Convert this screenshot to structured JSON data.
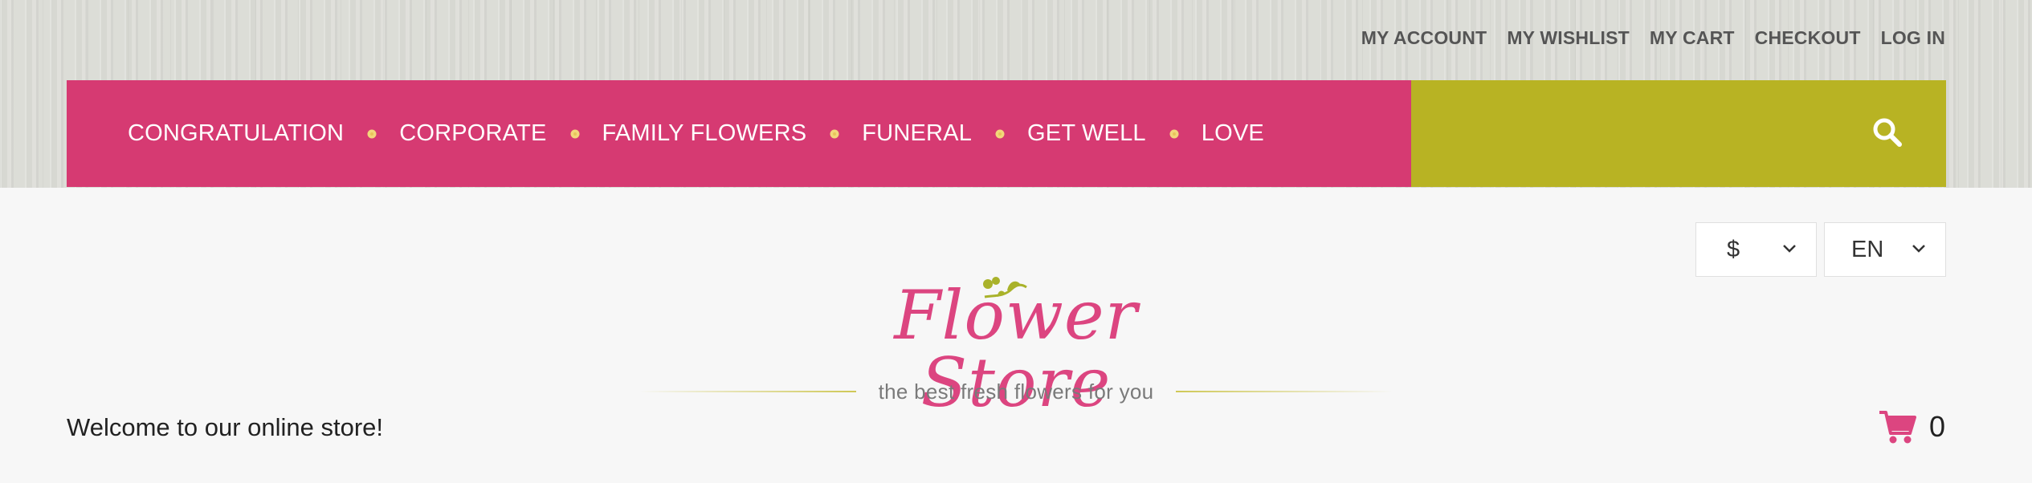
{
  "account_links": [
    "MY ACCOUNT",
    "MY WISHLIST",
    "MY CART",
    "CHECKOUT",
    "LOG IN"
  ],
  "nav": {
    "items": [
      "CONGRATULATION",
      "CORPORATE",
      "FAMILY FLOWERS",
      "FUNERAL",
      "GET WELL",
      "LOVE"
    ],
    "separator_icon": "flower-bullet-icon"
  },
  "search": {
    "icon": "search-icon"
  },
  "currency": {
    "value": "$",
    "icon": "chevron-down-icon"
  },
  "language": {
    "value": "EN",
    "icon": "chevron-down-icon"
  },
  "logo": {
    "title": "Flower Store",
    "tagline": "the best fresh flowers for you"
  },
  "welcome": "Welcome to our online store!",
  "cart": {
    "icon": "shopping-cart-icon",
    "count": "0"
  },
  "colors": {
    "nav_pink": "#d63a72",
    "search_olive": "#b8b323",
    "logo_pink": "#dc4580",
    "bullet_yellow": "#f2d77a"
  }
}
